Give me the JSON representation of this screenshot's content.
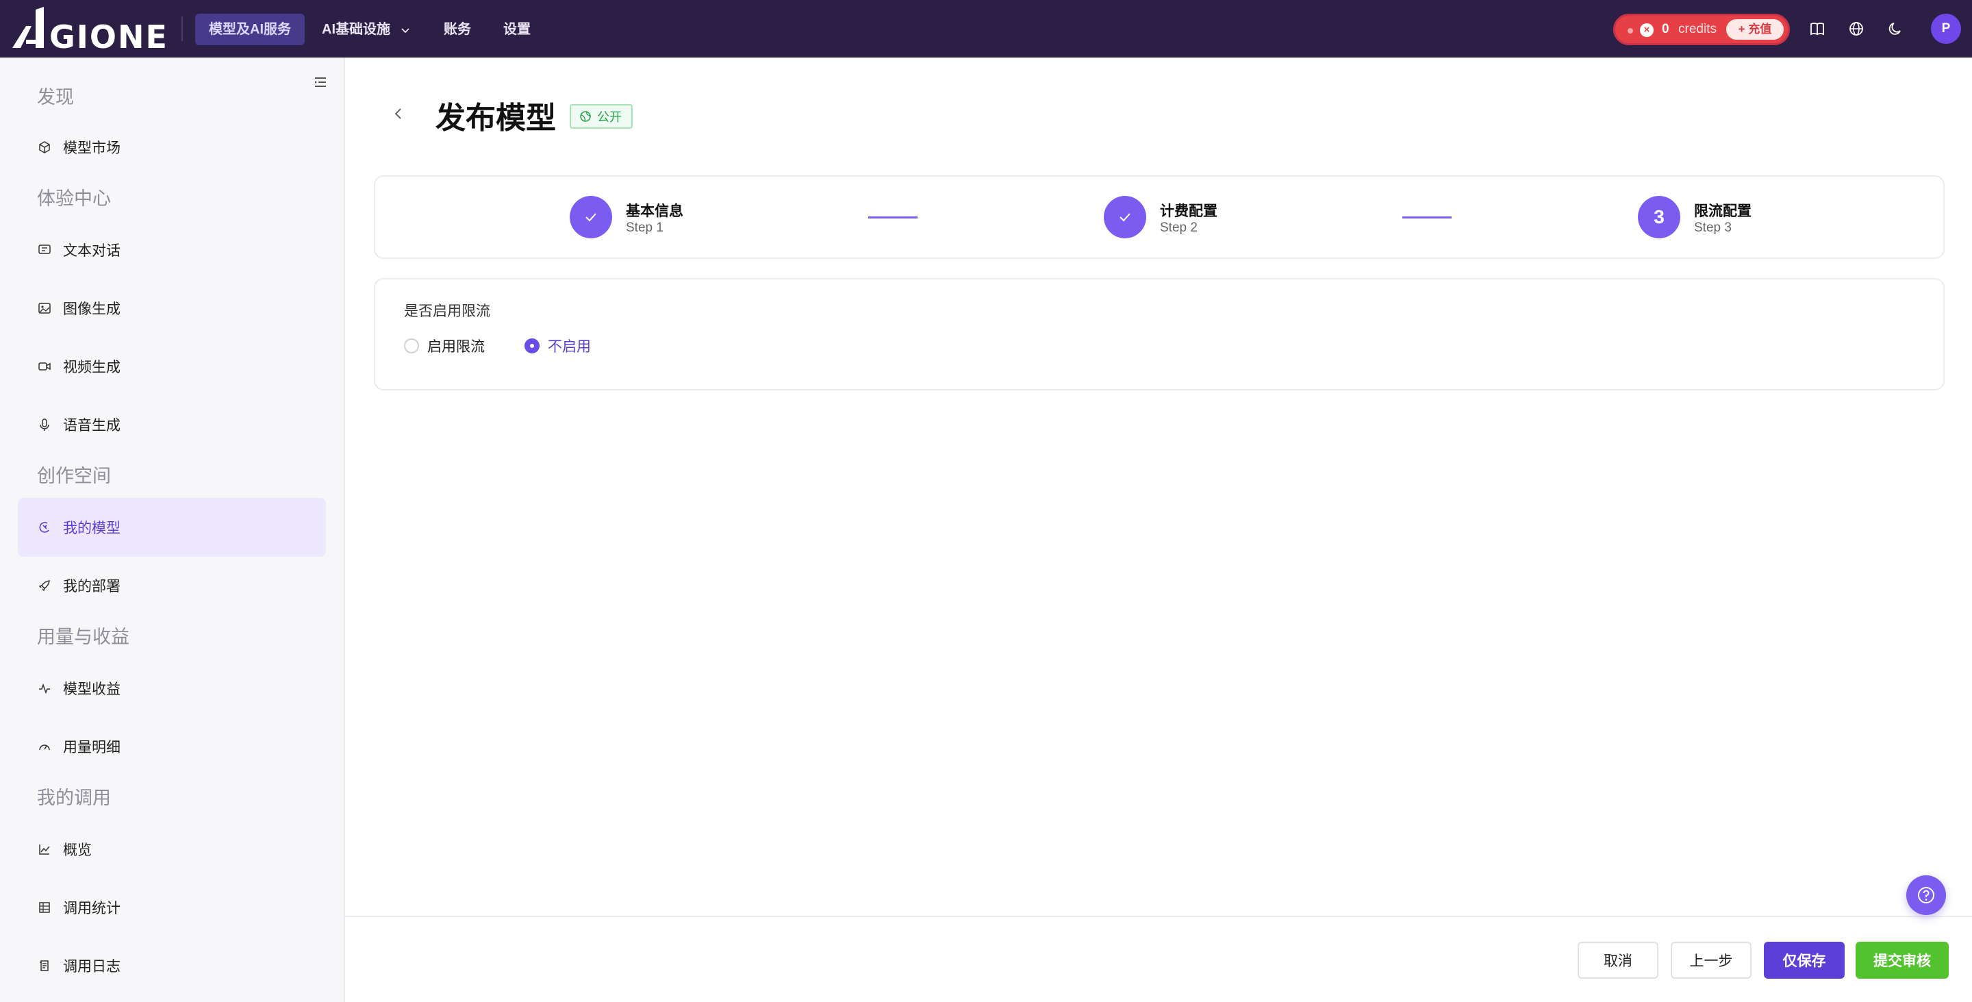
{
  "brand": {
    "logo_text": "AIGIONE",
    "accent": "#7b5cf0",
    "topbar_bg": "#2b1f46"
  },
  "topnav": {
    "items": [
      {
        "label": "模型及AI服务",
        "active": true
      },
      {
        "label": "AI基础设施",
        "has_dropdown": true
      },
      {
        "label": "账务"
      },
      {
        "label": "设置"
      }
    ],
    "credits": {
      "value": "0",
      "label": "credits",
      "recharge_label": "+ 充值"
    },
    "icons": [
      "book-icon",
      "globe-icon",
      "moon-icon"
    ],
    "avatar_initial": "P"
  },
  "sidebar": {
    "groups": [
      {
        "title": "发现",
        "items": [
          {
            "label": "模型市场",
            "icon": "cube-icon"
          }
        ]
      },
      {
        "title": "体验中心",
        "items": [
          {
            "label": "文本对话",
            "icon": "chat-icon"
          },
          {
            "label": "图像生成",
            "icon": "image-icon"
          },
          {
            "label": "视频生成",
            "icon": "video-icon"
          },
          {
            "label": "语音生成",
            "icon": "mic-icon"
          }
        ]
      },
      {
        "title": "创作空间",
        "items": [
          {
            "label": "我的模型",
            "icon": "model-icon",
            "active": true
          },
          {
            "label": "我的部署",
            "icon": "rocket-icon"
          }
        ]
      },
      {
        "title": "用量与收益",
        "items": [
          {
            "label": "模型收益",
            "icon": "activity-icon"
          },
          {
            "label": "用量明细",
            "icon": "gauge-icon"
          }
        ]
      },
      {
        "title": "我的调用",
        "items": [
          {
            "label": "概览",
            "icon": "chart-icon"
          },
          {
            "label": "调用统计",
            "icon": "table-icon"
          },
          {
            "label": "调用日志",
            "icon": "log-icon"
          }
        ]
      }
    ]
  },
  "page": {
    "title": "发布模型",
    "badge": "公开",
    "steps": [
      {
        "title": "基本信息",
        "sub": "Step 1",
        "status": "done"
      },
      {
        "title": "计费配置",
        "sub": "Step 2",
        "status": "done"
      },
      {
        "title": "限流配置",
        "sub": "Step 3",
        "status": "current",
        "number": "3"
      }
    ],
    "form": {
      "label": "是否启用限流",
      "options": [
        {
          "label": "启用限流",
          "checked": false
        },
        {
          "label": "不启用",
          "checked": true
        }
      ]
    },
    "footer": {
      "cancel": "取消",
      "prev": "上一步",
      "save": "仅保存",
      "submit": "提交审核"
    }
  }
}
